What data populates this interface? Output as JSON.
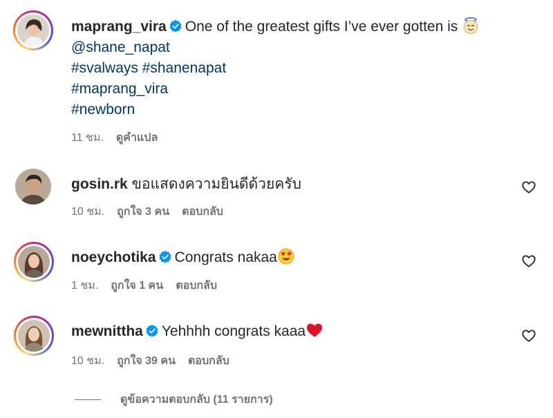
{
  "caption": {
    "username": "maprang_vira",
    "text": "One of the greatest gifts I’ve ever gotten is",
    "emoji": "angel-face",
    "mention": "@shane_napat",
    "hashtags_line1": "#svalways #shanenapat",
    "hashtag2": "#maprang_vira",
    "hashtag3": "#newborn",
    "time": "11 ชม.",
    "translate": "ดูคำแปล"
  },
  "comments": [
    {
      "username": "gosin.rk",
      "verified": false,
      "text": "ขอแสดงความยินดีด้วยครับ",
      "time": "10 ชม.",
      "likes": "ถูกใจ 3 คน",
      "reply": "ตอบกลับ"
    },
    {
      "username": "noeychotika",
      "verified": true,
      "text": "Congrats nakaa",
      "emoji": "heart-eyes-face",
      "time": "1 ชม.",
      "likes": "ถูกใจ 1 คน",
      "reply": "ตอบกลับ"
    },
    {
      "username": "mewnittha",
      "verified": true,
      "text": "Yehhhh congrats kaaa",
      "emoji": "red-heart",
      "time": "10 ชม.",
      "likes": "ถูกใจ 39 คน",
      "reply": "ตอบกลับ"
    }
  ],
  "view_replies": "ดูข้อความตอบกลับ (11 รายการ)",
  "colors": {
    "link": "#00376b",
    "verified": "#0095f6",
    "muted": "#737373"
  }
}
